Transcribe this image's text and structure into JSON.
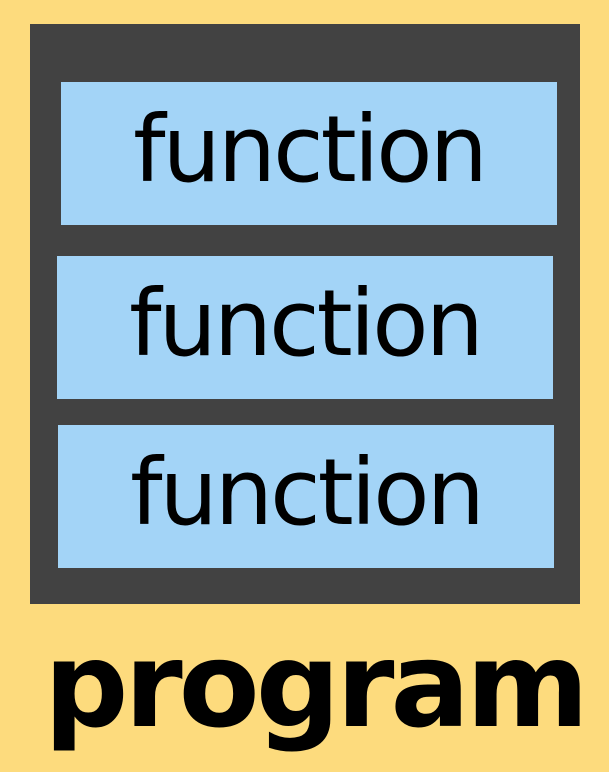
{
  "program": {
    "label": "program",
    "functions": [
      {
        "label": "function"
      },
      {
        "label": "function"
      },
      {
        "label": "function"
      }
    ]
  },
  "colors": {
    "background": "#fddb7d",
    "container": "#424242",
    "function_block": "#a3d4f7",
    "text": "#000000"
  }
}
